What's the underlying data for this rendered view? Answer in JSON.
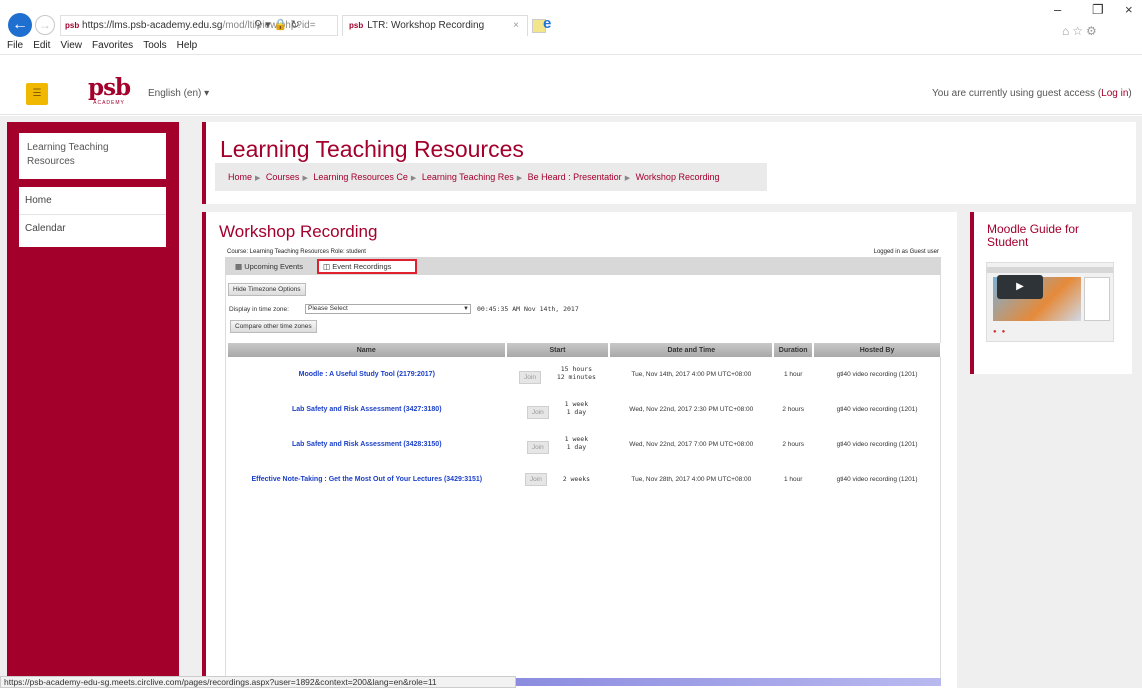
{
  "browser": {
    "url_prefix": "https://lms.psb-academy.edu.sg",
    "url_rest": "/mod/lti/view.php?id=",
    "tab_title": "LTR: Workshop Recording",
    "favicon_text": "psb",
    "menu": [
      "File",
      "Edit",
      "View",
      "Favorites",
      "Tools",
      "Help"
    ],
    "status_url": "https://psb-academy-edu-sg.meets.circlive.com/pages/recordings.aspx?user=1892&context=200&lang=en&role=11"
  },
  "header": {
    "logo": "psb",
    "logo_sub": "ACADEMY",
    "language": "English (en) ▾",
    "guest_text": "You are currently using guest access (",
    "login_link": "Log in",
    "guest_close": ")"
  },
  "sidebar": {
    "course": "Learning Teaching Resources",
    "items": [
      "Home",
      "Calendar"
    ]
  },
  "page": {
    "title": "Learning Teaching Resources",
    "breadcrumb": [
      "Home",
      "Courses",
      "Learning Resources Ce",
      "Learning Teaching Res",
      "Be Heard : Presentatior",
      "Workshop Recording"
    ],
    "activity_title": "Workshop Recording"
  },
  "lti": {
    "course_label": "Course: Learning Teaching Resources     Role: student",
    "logged_in": "Logged in as Guest user",
    "tabs": {
      "upcoming": "Upcoming Events",
      "recordings": "Event Recordings"
    },
    "hide_tz": "Hide Timezone Options",
    "tz_label": "Display in time zone:",
    "tz_select": "Please Select",
    "tz_time": "00:45:35 AM Nov 14th, 2017",
    "compare_tz": "Compare other time zones",
    "columns": [
      "Name",
      "Start",
      "Date and Time",
      "Duration",
      "Hosted By"
    ],
    "rows": [
      {
        "name": "Moodle : A Useful Study Tool (2179:2017)",
        "join": "Join",
        "start1": "15 hours",
        "start2": "12 minutes",
        "date": "Tue, Nov 14th, 2017 4:00 PM UTC+08:00",
        "duration": "1 hour",
        "host": "gtl40 video recording (1201)"
      },
      {
        "name": "Lab Safety and Risk Assessment (3427:3180)",
        "join": "Join",
        "start1": "1 week",
        "start2": "1 day",
        "date": "Wed, Nov 22nd, 2017 2:30 PM UTC+08:00",
        "duration": "2 hours",
        "host": "gtl40 video recording (1201)"
      },
      {
        "name": "Lab Safety and Risk Assessment (3428:3150)",
        "join": "Join",
        "start1": "1 week",
        "start2": "1 day",
        "date": "Wed, Nov 22nd, 2017 7:00 PM UTC+08:00",
        "duration": "2 hours",
        "host": "gtl40 video recording (1201)"
      },
      {
        "name": "Effective Note-Taking : Get the Most Out of Your Lectures (3429:3151)",
        "join": "Join",
        "start1": "2 weeks",
        "start2": "",
        "date": "Tue, Nov 28th, 2017 4:00 PM UTC+08:00",
        "duration": "1 hour",
        "host": "gtl40 video recording (1201)"
      }
    ]
  },
  "side_block": {
    "title": "Moodle Guide for Student"
  }
}
